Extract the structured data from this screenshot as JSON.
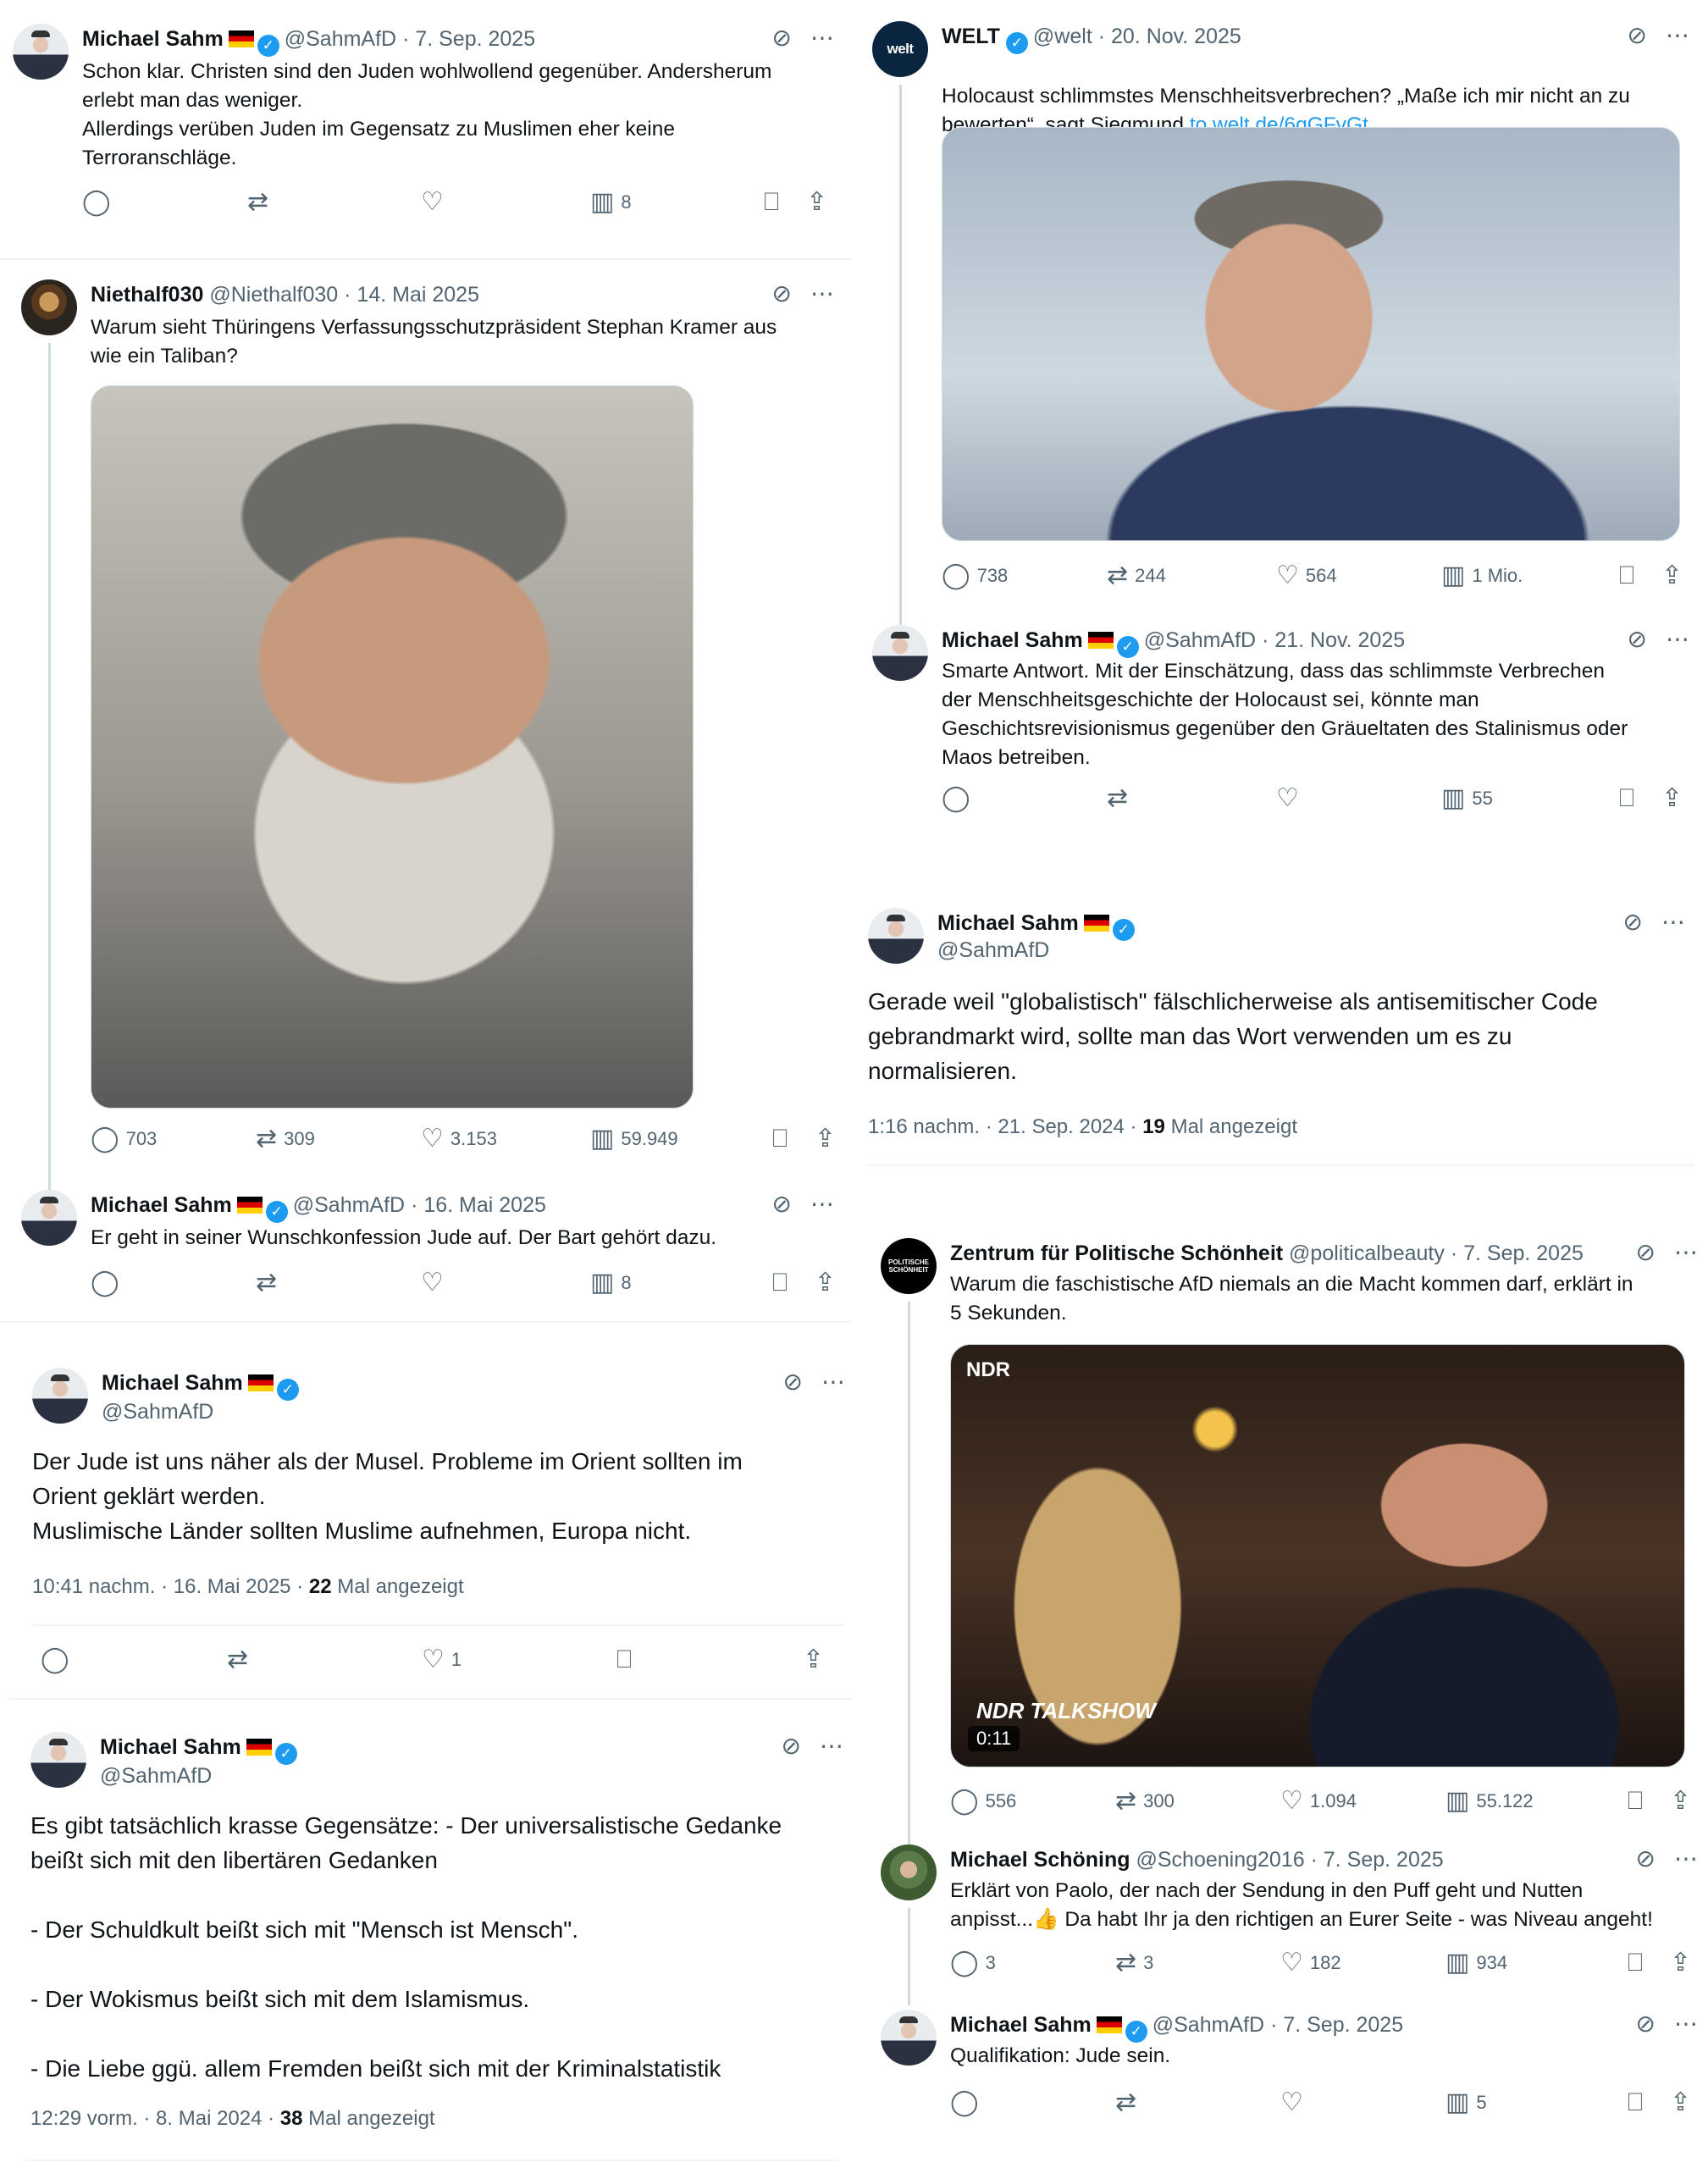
{
  "tweets": {
    "t1": {
      "name": "Michael Sahm",
      "handle": "@SahmAfD",
      "date": "· 7. Sep. 2025",
      "text": "Schon klar. Christen sind den Juden wohlwollend gegenüber. Andersherum\nerlebt man das weniger.\nAllerdings verüben Juden im Gegensatz zu Muslimen eher keine\nTerroranschläge.",
      "views": "8"
    },
    "t2": {
      "name": "Niethalf030",
      "handle": "@Niethalf030",
      "date": "· 14. Mai 2025",
      "text": "Warum sieht Thüringens Verfassungsschutzpräsident Stephan Kramer aus\nwie ein Taliban?",
      "replies": "703",
      "reposts": "309",
      "likes": "3.153",
      "views": "59.949"
    },
    "t3": {
      "name": "Michael Sahm",
      "handle": "@SahmAfD",
      "date": "· 16. Mai 2025",
      "text": "Er geht in seiner Wunschkonfession Jude auf. Der Bart gehört dazu.",
      "views": "8"
    },
    "t4": {
      "name": "Michael Sahm",
      "handle": "@SahmAfD",
      "text": "Der Jude ist uns näher als der Musel. Probleme im Orient sollten im\nOrient geklärt werden.\nMuslimische Länder sollten Muslime aufnehmen, Europa nicht.",
      "time": "10:41 nachm. · 16. Mai 2025 · ",
      "views_count": "22",
      "views_label": " Mal angezeigt",
      "likes": "1"
    },
    "t5": {
      "name": "Michael Sahm",
      "handle": "@SahmAfD",
      "text": "Es gibt tatsächlich krasse Gegensätze: - Der universalistische Gedanke\nbeißt sich mit den libertären Gedanken\n\n- Der Schuldkult beißt sich mit \"Mensch ist Mensch\".\n\n- Der Wokismus beißt sich mit dem Islamismus.\n\n- Die Liebe ggü. allem Fremden beißt sich mit der Kriminalstatistik",
      "time": "12:29 vorm. · 8. Mai 2024 · ",
      "views_count": "38",
      "views_label": " Mal angezeigt"
    },
    "t6": {
      "name": "WELT",
      "handle": "@welt",
      "date": "· 20. Nov. 2025",
      "text": "Holocaust schlimmstes Menschheitsverbrechen? „Maße ich mir nicht an zu\nbewerten“, sagt Siegmund ",
      "link": "to.welt.de/6gGFvGt",
      "replies": "738",
      "reposts": "244",
      "likes": "564",
      "views": "1 Mio."
    },
    "t7": {
      "name": "Michael Sahm",
      "handle": "@SahmAfD",
      "date": "· 21. Nov. 2025",
      "text": "Smarte Antwort. Mit der Einschätzung, dass das schlimmste Verbrechen\nder Menschheitsgeschichte der Holocaust sei, könnte man\nGeschichtsrevisionismus gegenüber den Gräueltaten des Stalinismus oder\nMaos betreiben.",
      "views": "55"
    },
    "t8": {
      "name": "Michael Sahm",
      "handle": "@SahmAfD",
      "text": "Gerade weil \"globalistisch\" fälschlicherweise als antisemitischer Code\ngebrandmarkt wird, sollte man das Wort verwenden um es zu\nnormalisieren.",
      "time": "1:16 nachm. · 21. Sep. 2024 · ",
      "views_count": "19",
      "views_label": " Mal angezeigt"
    },
    "t9": {
      "name": "Zentrum für Politische Schönheit",
      "handle": "@politicalbeauty",
      "date": "· 7. Sep. 2025",
      "text": "Warum die faschistische AfD niemals an die Macht kommen darf, erklärt in\n5 Sekunden.",
      "video_brand": "NDR",
      "video_show": "NDR TALKSHOW",
      "video_duration": "0:11",
      "replies": "556",
      "reposts": "300",
      "likes": "1.094",
      "views": "55.122"
    },
    "t10": {
      "name": "Michael Schöning",
      "handle": "@Schoening2016",
      "date": "· 7. Sep. 2025",
      "text": "Erklärt von Paolo, der nach der Sendung in den Puff geht und Nutten\nanpisst...👍 Da habt Ihr ja den richtigen an Eurer Seite - was Niveau angeht!",
      "replies": "3",
      "reposts": "3",
      "likes": "182",
      "views": "934"
    },
    "t11": {
      "name": "Michael Sahm",
      "handle": "@SahmAfD",
      "date": "· 7. Sep. 2025",
      "text": "Qualifikation: Jude sein.",
      "views": "5"
    }
  },
  "avatar_text": {
    "welt": "welt",
    "zps": "POLITISCHE SCHÖNHEIT"
  },
  "icons": {
    "grok": "grok-icon",
    "more": "more-icon",
    "reply": "reply-icon",
    "repost": "repost-icon",
    "like": "like-icon",
    "views": "views-icon",
    "bookmark": "bookmark-icon",
    "share": "share-icon"
  },
  "colors": {
    "verified": "#1d9bf0",
    "link": "#1d9bf0",
    "meta": "#536471",
    "text": "#0f1419"
  }
}
